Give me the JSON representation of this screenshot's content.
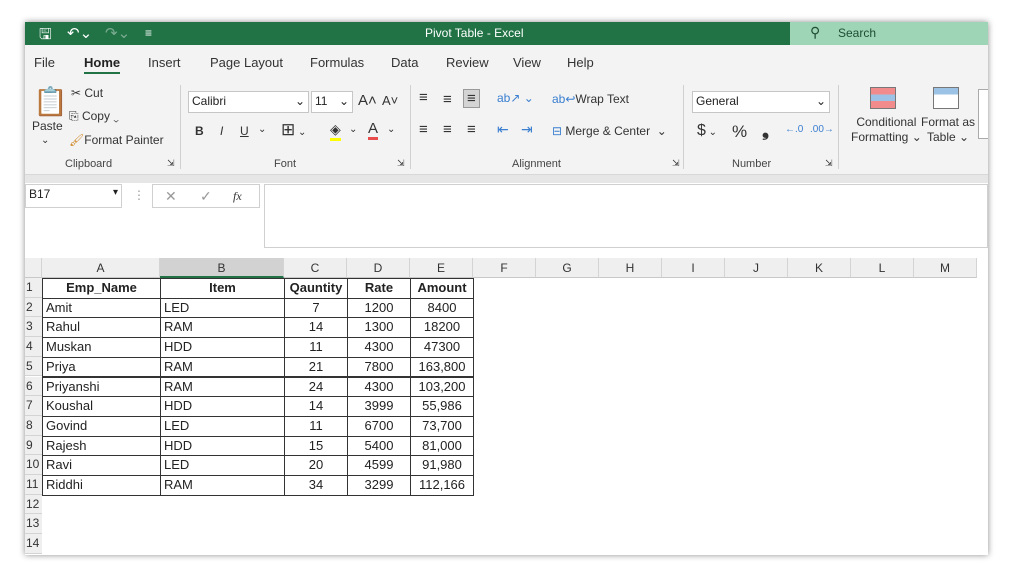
{
  "app": {
    "title": "Pivot Table  -  Excel",
    "search": "Search",
    "colors": {
      "brand": "#217346",
      "search_bg": "#9fd5b7"
    }
  },
  "quick_access": [
    {
      "icon": "save-icon",
      "glyph": "🖫"
    },
    {
      "icon": "undo-icon",
      "glyph": "↶"
    },
    {
      "icon": "redo-icon",
      "glyph": "↷"
    },
    {
      "icon": "customize-icon",
      "glyph": "⌄"
    }
  ],
  "tabs": [
    "File",
    "Home",
    "Insert",
    "Page Layout",
    "Formulas",
    "Data",
    "Review",
    "View",
    "Help"
  ],
  "active_tab": "Home",
  "ribbon": {
    "clipboard": {
      "paste": "Paste",
      "cut": "Cut",
      "copy": "Copy",
      "format_painter": "Format Painter",
      "label": "Clipboard"
    },
    "font": {
      "name": "Calibri",
      "size": "11",
      "bold": "B",
      "italic": "I",
      "underline": "U",
      "label": "Font"
    },
    "alignment": {
      "wrap": "Wrap Text",
      "merge": "Merge & Center",
      "label": "Alignment"
    },
    "number": {
      "format": "General",
      "currency": "$",
      "percent": "%",
      "comma": "❟",
      "label": "Number"
    },
    "styles": {
      "conditional": "Conditional",
      "conditional2": "Formatting",
      "format_as": "Format as",
      "format_as2": "Table"
    }
  },
  "formula_bar": {
    "name_box": "B17",
    "fx": "fx",
    "value": ""
  },
  "columns": [
    "A",
    "B",
    "C",
    "D",
    "E",
    "F",
    "G",
    "H",
    "I",
    "J",
    "K",
    "L",
    "M"
  ],
  "rows": [
    "1",
    "2",
    "3",
    "4",
    "5",
    "6",
    "7",
    "8",
    "9",
    "10",
    "11",
    "12",
    "13",
    "14"
  ],
  "table": {
    "headers": [
      "Emp_Name",
      "Item",
      "Qauntity",
      "Rate",
      "Amount"
    ],
    "rows": [
      [
        "Amit",
        "LED",
        "7",
        "1200",
        "8400"
      ],
      [
        "Rahul",
        "RAM",
        "14",
        "1300",
        "18200"
      ],
      [
        "Muskan",
        "HDD",
        "11",
        "4300",
        "47300"
      ],
      [
        "Priya",
        "RAM",
        "21",
        "7800",
        "163,800"
      ],
      [
        "Priyanshi",
        "RAM",
        "24",
        "4300",
        "103,200"
      ],
      [
        "Koushal",
        "HDD",
        "14",
        "3999",
        "55,986"
      ],
      [
        "Govind",
        "LED",
        "11",
        "6700",
        "73,700"
      ],
      [
        "Rajesh",
        "HDD",
        "15",
        "5400",
        "81,000"
      ],
      [
        "Ravi",
        "LED",
        "20",
        "4599",
        "91,980"
      ],
      [
        "Riddhi",
        "RAM",
        "34",
        "3299",
        "112,166"
      ]
    ]
  }
}
